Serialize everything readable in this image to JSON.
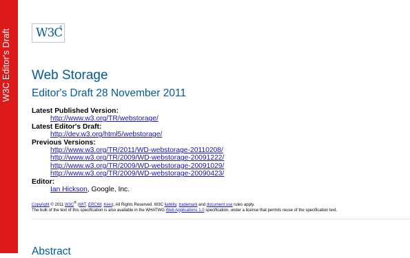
{
  "banner": {
    "text": "W3C Editor's Draft"
  },
  "logo": {
    "text": "W3C",
    "reg": "®"
  },
  "title": "Web Storage",
  "subtitle": "Editor's Draft 28 November 2011",
  "meta": {
    "latest_published": {
      "label": "Latest Published Version:",
      "url": "http://www.w3.org/TR/webstorage/"
    },
    "latest_editors": {
      "label": "Latest Editor's Draft:",
      "url": "http://dev.w3.org/html5/webstorage/"
    },
    "previous": {
      "label": "Previous Versions:",
      "urls": [
        "http://www.w3.org/TR/2011/WD-webstorage-20110208/",
        "http://www.w3.org/TR/2009/WD-webstorage-20091222/",
        "http://www.w3.org/TR/2009/WD-webstorage-20091029/",
        "http://www.w3.org/TR/2009/WD-webstorage-20090423/"
      ]
    },
    "editor": {
      "label": "Editor:",
      "name": "Ian Hickson",
      "affiliation": ", Google, Inc."
    }
  },
  "copyright": {
    "copyright_link": "Copyright",
    "year": " © 2011 ",
    "w3c": "W3C",
    "reg": "®",
    "open_paren": " (",
    "mit": "MIT",
    "ercim": "ERCIM",
    "keio": "Keio",
    "rights": "), All Rights Reserved. W3C ",
    "liability": "liability",
    "trademark": "trademark",
    "and": " and ",
    "document_use": "document use",
    "rules": " rules apply.",
    "line2_pre": "The bulk of the text of this specification is also available in the WHATWG ",
    "whatwg_link": "Web Applications 1.0",
    "line2_post": " specification, under a license that permits reuse of the specification text."
  },
  "abstract": {
    "heading": "Abstract"
  }
}
